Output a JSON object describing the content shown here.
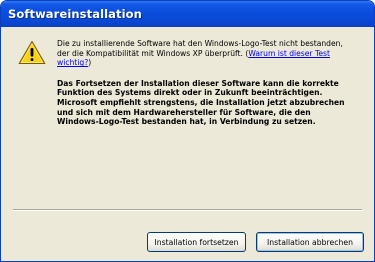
{
  "window": {
    "title": "Softwareinstallation"
  },
  "icon": {
    "name": "warning-icon",
    "color": "#f6d31b"
  },
  "message": {
    "note_line1": "Die zu installierende Software hat den Windows-Logo-Test nicht bestanden,",
    "note_line2_prefix": "der die Kompatibilität mit Windows XP überprüft. (",
    "note_link_part1": "Warum ist dieser Test",
    "note_link_part2": "wichtig?",
    "note_suffix": ")",
    "warning_lines": [
      "Das Fortsetzen der Installation dieser Software kann die korrekte",
      "Funktion des Systems direkt oder in Zukunft beeinträchtigen.",
      "Microsoft empfiehlt strengstens, die Installation jetzt abzubrechen",
      "und sich mit dem Hardwarehersteller für Software, die den",
      "Windows-Logo-Test bestanden hat, in Verbindung zu setzen."
    ]
  },
  "buttons": {
    "continue_label": "Installation fortsetzen",
    "abort_label": "Installation abbrechen"
  }
}
